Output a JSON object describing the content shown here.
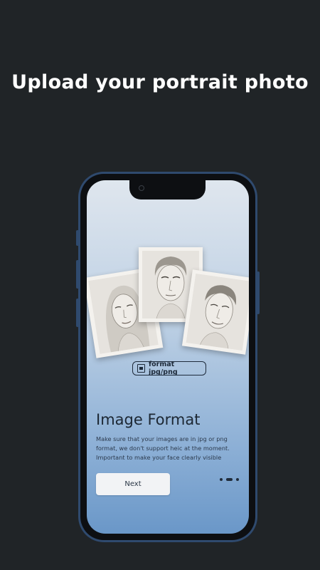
{
  "headline": "Upload your portrait photo",
  "onboarding": {
    "format_badge": "format jpg/png",
    "title": "Image Format",
    "description": "Make sure that your images are in jpg or png format, we don't support heic at the moment. Important to make your face clearly visible",
    "next_label": "Next",
    "page_indicator": {
      "total": 3,
      "active": 2
    }
  },
  "colors": {
    "background": "#202427",
    "phone_frame": "#2f4a6e",
    "gradient_top": "#dfe6ee",
    "gradient_bottom": "#6a97c8",
    "text_dark": "#1c2733"
  },
  "icons": [
    "camera-icon",
    "image-file-icon"
  ]
}
